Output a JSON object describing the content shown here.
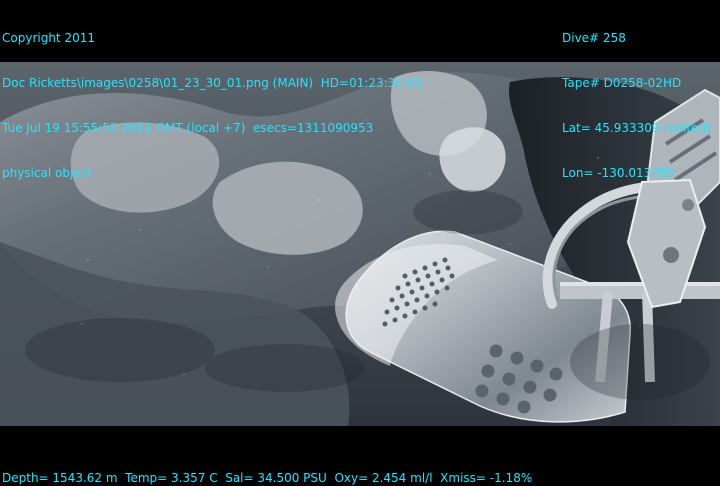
{
  "overlay": {
    "left_lines": [
      "Copyright 2011",
      "Doc Ricketts\\images\\0258\\01_23_30_01.png (MAIN)  HD=01:23:30:01",
      "Tue Jul 19 15:55:53 2011 GMT (local +7)  esecs=1311090953",
      "physical object"
    ],
    "right_lines": [
      "Dive# 258",
      "Tape# D0258-02HD",
      "Lat= 45.933309 (edited)",
      "Lon= -130.013785"
    ],
    "bottom_line": "Depth= 1543.62 m  Temp= 3.357 C  Sal= 34.500 PSU  Oxy= 2.454 ml/l  Xmiss= -1.18%"
  },
  "colors": {
    "overlay_text": "#21e6ff",
    "letterbox": "#000000"
  }
}
